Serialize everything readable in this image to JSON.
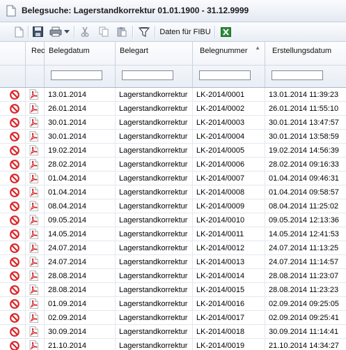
{
  "window": {
    "title": "Belegsuche: Lagerstandkorrektur 01.01.1900 - 31.12.9999"
  },
  "toolbar": {
    "fibu_label": "Daten für FIBU",
    "icons": [
      "new-document",
      "save",
      "print",
      "print-dropdown",
      "cut",
      "copy",
      "paste",
      "filter",
      "excel"
    ]
  },
  "columns": [
    {
      "key": "status",
      "label": ""
    },
    {
      "key": "rec",
      "label": "Rec"
    },
    {
      "key": "belegdatum",
      "label": "Belegdatum"
    },
    {
      "key": "belegart",
      "label": "Belegart"
    },
    {
      "key": "belegnummer",
      "label": "Belegnummer",
      "sorted": "ascending"
    },
    {
      "key": "erstellungsdatum",
      "label": "Erstellungsdatum"
    }
  ],
  "filters": {
    "belegdatum": "",
    "belegart": "",
    "belegnummer": "",
    "erstellungsdatum": ""
  },
  "rows": [
    {
      "belegdatum": "13.01.2014",
      "belegart": "Lagerstandkorrektur",
      "belegnummer": "LK-2014/0001",
      "erstellungsdatum": "13.01.2014 11:39:23"
    },
    {
      "belegdatum": "26.01.2014",
      "belegart": "Lagerstandkorrektur",
      "belegnummer": "LK-2014/0002",
      "erstellungsdatum": "26.01.2014 11:55:10"
    },
    {
      "belegdatum": "30.01.2014",
      "belegart": "Lagerstandkorrektur",
      "belegnummer": "LK-2014/0003",
      "erstellungsdatum": "30.01.2014 13:47:57"
    },
    {
      "belegdatum": "30.01.2014",
      "belegart": "Lagerstandkorrektur",
      "belegnummer": "LK-2014/0004",
      "erstellungsdatum": "30.01.2014 13:58:59"
    },
    {
      "belegdatum": "19.02.2014",
      "belegart": "Lagerstandkorrektur",
      "belegnummer": "LK-2014/0005",
      "erstellungsdatum": "19.02.2014 14:56:39"
    },
    {
      "belegdatum": "28.02.2014",
      "belegart": "Lagerstandkorrektur",
      "belegnummer": "LK-2014/0006",
      "erstellungsdatum": "28.02.2014 09:16:33"
    },
    {
      "belegdatum": "01.04.2014",
      "belegart": "Lagerstandkorrektur",
      "belegnummer": "LK-2014/0007",
      "erstellungsdatum": "01.04.2014 09:46:31"
    },
    {
      "belegdatum": "01.04.2014",
      "belegart": "Lagerstandkorrektur",
      "belegnummer": "LK-2014/0008",
      "erstellungsdatum": "01.04.2014 09:58:57"
    },
    {
      "belegdatum": "08.04.2014",
      "belegart": "Lagerstandkorrektur",
      "belegnummer": "LK-2014/0009",
      "erstellungsdatum": "08.04.2014 11:25:02"
    },
    {
      "belegdatum": "09.05.2014",
      "belegart": "Lagerstandkorrektur",
      "belegnummer": "LK-2014/0010",
      "erstellungsdatum": "09.05.2014 12:13:36"
    },
    {
      "belegdatum": "14.05.2014",
      "belegart": "Lagerstandkorrektur",
      "belegnummer": "LK-2014/0011",
      "erstellungsdatum": "14.05.2014 12:41:53"
    },
    {
      "belegdatum": "24.07.2014",
      "belegart": "Lagerstandkorrektur",
      "belegnummer": "LK-2014/0012",
      "erstellungsdatum": "24.07.2014 11:13:25"
    },
    {
      "belegdatum": "24.07.2014",
      "belegart": "Lagerstandkorrektur",
      "belegnummer": "LK-2014/0013",
      "erstellungsdatum": "24.07.2014 11:14:57"
    },
    {
      "belegdatum": "28.08.2014",
      "belegart": "Lagerstandkorrektur",
      "belegnummer": "LK-2014/0014",
      "erstellungsdatum": "28.08.2014 11:23:07"
    },
    {
      "belegdatum": "28.08.2014",
      "belegart": "Lagerstandkorrektur",
      "belegnummer": "LK-2014/0015",
      "erstellungsdatum": "28.08.2014 11:23:23"
    },
    {
      "belegdatum": "01.09.2014",
      "belegart": "Lagerstandkorrektur",
      "belegnummer": "LK-2014/0016",
      "erstellungsdatum": "02.09.2014 09:25:05"
    },
    {
      "belegdatum": "02.09.2014",
      "belegart": "Lagerstandkorrektur",
      "belegnummer": "LK-2014/0017",
      "erstellungsdatum": "02.09.2014 09:25:41"
    },
    {
      "belegdatum": "30.09.2014",
      "belegart": "Lagerstandkorrektur",
      "belegnummer": "LK-2014/0018",
      "erstellungsdatum": "30.09.2014 11:14:41"
    },
    {
      "belegdatum": "21.10.2014",
      "belegart": "Lagerstandkorrektur",
      "belegnummer": "LK-2014/0019",
      "erstellungsdatum": "21.10.2014 14:34:27"
    }
  ],
  "row_icons": {
    "status": "cancel-circle",
    "document": "pdf-document"
  },
  "colors": {
    "cancel_red": "#d8282b",
    "pdf_red": "#d0232a",
    "header_gradient_bottom": "#e9eef5"
  }
}
